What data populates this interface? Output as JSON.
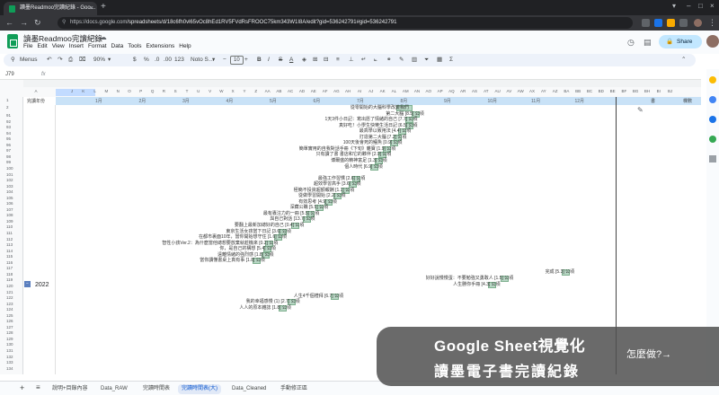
{
  "browser": {
    "tab_title": "讀墨Readmoo完讀紀錄 - Goo…",
    "tab_close": "×",
    "new_tab": "+",
    "url_host": "https://docs.google.com",
    "url_path": "/spreadsheets/d/18c6fh0vl65vOc8hEd1RV5FVdRsFROOC75km343W1I8A/edit?gid=536242791#gid=536242791",
    "window_controls": [
      "▾",
      "–",
      "□",
      "×"
    ]
  },
  "doc": {
    "title": "讀墨Readmoo完讀紀錄",
    "menu": [
      "File",
      "Edit",
      "View",
      "Insert",
      "Format",
      "Data",
      "Tools",
      "Extensions",
      "Help"
    ],
    "share_label": "Share"
  },
  "toolbar": {
    "menus_label": "Menus",
    "zoom": "90%",
    "currency": "$",
    "percent": "%",
    "dec_less": ".0",
    "dec_more": ".00",
    "number_format": "123",
    "font": "Noto S…",
    "font_size": "10",
    "bold": "B",
    "italic": "I",
    "strike": "S",
    "text_color": "A"
  },
  "formula_bar": {
    "name_box": "J79",
    "fx": "fx"
  },
  "grid": {
    "col_letters": [
      "A",
      "J",
      "K",
      "L",
      "M",
      "N",
      "O",
      "P",
      "Q",
      "R",
      "S",
      "T",
      "U",
      "V",
      "W",
      "X",
      "Y",
      "Z",
      "AA",
      "AB",
      "AC",
      "AD",
      "AE",
      "AF",
      "AG",
      "AH",
      "AI",
      "AJ",
      "AK",
      "AL",
      "AM",
      "AN",
      "AO",
      "AP",
      "AQ",
      "AR",
      "AS",
      "AT",
      "AU",
      "AV",
      "AW",
      "AX",
      "AY",
      "AZ",
      "BA",
      "BB",
      "BC",
      "BD",
      "BE",
      "BF",
      "BG",
      "BH",
      "BI",
      "BJ"
    ],
    "b2_label": "完讀年份",
    "months": [
      "1月",
      "2月",
      "3月",
      "4月",
      "5月",
      "6月",
      "7月",
      "8月",
      "9月",
      "10月",
      "11月",
      "12月"
    ],
    "right_headers": [
      "書",
      "棵數"
    ],
    "year": "2022",
    "group_button": "−",
    "row_numbers": [
      "1",
      "2",
      "91",
      "92",
      "93",
      "94",
      "95",
      "96",
      "97",
      "98",
      "99",
      "100",
      "101",
      "102",
      "103",
      "104",
      "105",
      "106",
      "107",
      "108",
      "109",
      "110",
      "111",
      "112",
      "113",
      "114",
      "115",
      "116",
      "117",
      "118",
      "119",
      "120",
      "121",
      "122",
      "123",
      "124",
      "125",
      "126",
      "127",
      "128",
      "129",
      "130",
      "131",
      "132",
      "133",
      "134"
    ],
    "books": [
      {
        "text": "從零開始的大腦科學改變我們",
        "row": 0,
        "month_pos": 8.1,
        "len": 0.6
      },
      {
        "text": "第二大腦 [8.5] 公頃",
        "row": 1,
        "month_pos": 8.45,
        "len": 0.3
      },
      {
        "text": "1天3件小日記：寫出愿了情緒的自己 [7.7] 公頃",
        "row": 2,
        "month_pos": 8.3,
        "len": 0.3
      },
      {
        "text": "真好吃！小學生快樂生活日記 [6.5] 公頃",
        "row": 3,
        "month_pos": 8.3,
        "len": 0.3
      },
      {
        "text": "最高學以致用法 [4.4] 公頃",
        "row": 4,
        "month_pos": 8.15,
        "len": 0.3
      },
      {
        "text": "打造第二大腦 [7.2] 公頃",
        "row": 5,
        "month_pos": 8.05,
        "len": 0.3
      },
      {
        "text": "100天後會死的鱷魚 [0.9] 公頃",
        "row": 6,
        "month_pos": 7.95,
        "len": 0.3
      },
      {
        "text": "簡單實用的自我對話手冊《下旬》雜寶 [1.9] 公頃",
        "row": 7,
        "month_pos": 7.8,
        "len": 0.3
      },
      {
        "text": "只有讀了書 書店和它的夥伴 [2.9] 公頃",
        "row": 8,
        "month_pos": 7.7,
        "len": 0.3
      },
      {
        "text": "博爾盛的精神富足 [1.3] 公頃",
        "row": 9,
        "month_pos": 7.6,
        "len": 0.3
      },
      {
        "text": "個人時代 [6.9] 公頃",
        "row": 10,
        "month_pos": 7.5,
        "len": 0.3
      },
      {
        "text": "最強工作習慣 [2.6] 公頃",
        "row": 12,
        "month_pos": 7.1,
        "len": 0.3
      },
      {
        "text": "超效學習高手 [3.6] 公頃",
        "row": 13,
        "month_pos": 7.0,
        "len": 0.3
      },
      {
        "text": "極簡不投資超額報酬 [1.1] 公頃",
        "row": 14,
        "month_pos": 6.85,
        "len": 0.3
      },
      {
        "text": "從做學習開始 [2.2] 公頃",
        "row": 15,
        "month_pos": 6.65,
        "len": 0.3
      },
      {
        "text": "有效思考 [4.9] 公頃",
        "row": 16,
        "month_pos": 6.45,
        "len": 0.3
      },
      {
        "text": "深藏公職 [5.5] 公頃",
        "row": 17,
        "month_pos": 6.25,
        "len": 0.3
      },
      {
        "text": "最有專注力的一冊 [5.5] 公頃",
        "row": 18,
        "month_pos": 6.05,
        "len": 0.3
      },
      {
        "text": "與自己對話 [13.7] 公頃",
        "row": 19,
        "month_pos": 5.95,
        "len": 0.3
      },
      {
        "text": "要翻上最新加總好的自己 [0.4] 公頃",
        "row": 20,
        "month_pos": 5.7,
        "len": 0.3
      },
      {
        "text": "東京生活女孩當下日記 [3.6] 公頃",
        "row": 21,
        "month_pos": 5.4,
        "len": 0.3
      },
      {
        "text": "在都市裏面10年，當你開始想守住 [1.6] 公頃",
        "row": 22,
        "month_pos": 5.3,
        "len": 0.3
      },
      {
        "text": "智性小孩Ver.2：為什麼當他總想要放棄就趁機來 [0.2] 公頃",
        "row": 23,
        "month_pos": 5.1,
        "len": 0.3
      },
      {
        "text": "你，是自己的構想 [5.4] 公頃",
        "row": 24,
        "month_pos": 5.05,
        "len": 0.3
      },
      {
        "text": "遠離情緒的強烈感 [1.8] 公頃",
        "row": 25,
        "month_pos": 5.0,
        "len": 0.3
      },
      {
        "text": "當你讀懂書桌上真有事 [1.8] 公頃",
        "row": 26,
        "month_pos": 4.8,
        "len": 0.3
      },
      {
        "text": "完成 [5.3] 公頃",
        "row": 28,
        "month_pos": 11.9,
        "len": 0.3
      },
      {
        "text": "好好說慢慢蛋：不要勉強又勇敢人 [1.5] 公頃",
        "row": 29,
        "month_pos": 10.5,
        "len": 0.3
      },
      {
        "text": "人生勝你手冊 [4.3] 公頃",
        "row": 30,
        "month_pos": 10.2,
        "len": 0.3
      },
      {
        "text": "人生4千個禮拜 [6.7] 公頃",
        "row": 32,
        "month_pos": 6.6,
        "len": 0.3
      },
      {
        "text": "我的幸福感慢 (1) [2.7] 公頃",
        "row": 33,
        "month_pos": 5.6,
        "len": 0.3
      },
      {
        "text": "人人的原本雜誌 [1.8] 公頃",
        "row": 34,
        "month_pos": 5.4,
        "len": 0.3
      }
    ]
  },
  "sheets": {
    "tabs": [
      "說明+目錄內容",
      "Data_RAW",
      "完讀時間表",
      "完讀時間表(大)",
      "Data_Cleaned",
      "手動修正區"
    ],
    "active_index": 3
  },
  "banner": {
    "line1": "Google Sheet視覺化",
    "line2": "讀墨電子書完讀紀錄",
    "cta": "怎麼做?→"
  }
}
